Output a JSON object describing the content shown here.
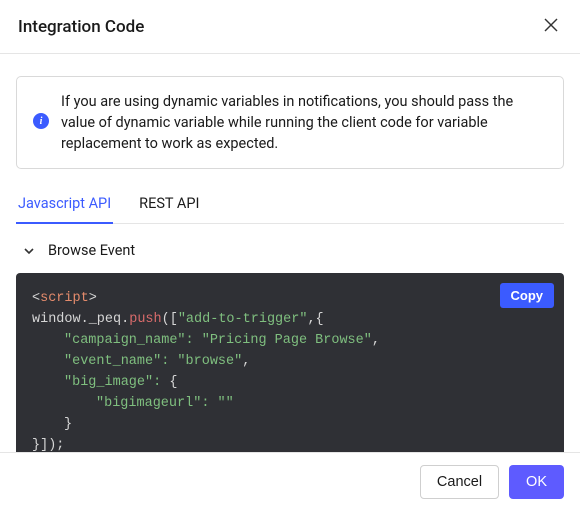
{
  "header": {
    "title": "Integration Code"
  },
  "info": {
    "text": "If you are using dynamic variables in notifications, you should pass the value of dynamic variable while running the client code for variable replacement to work as expected."
  },
  "tabs": {
    "js": "Javascript API",
    "rest": "REST API"
  },
  "section": {
    "title": "Browse Event"
  },
  "code": {
    "copy_label": "Copy",
    "script_tag": "script",
    "window_peq": "window._peq.",
    "push": "push",
    "open": "([",
    "add_to_trigger": "\"add-to-trigger\"",
    "after_trigger": ",{",
    "campaign_key": "\"campaign_name\": ",
    "campaign_val": "\"Pricing Page Browse\"",
    "event_key": "\"event_name\": ",
    "event_val": "\"browse\"",
    "bigimage_key": "\"big_image\": ",
    "bigimage_open": "{",
    "bigimageurl_key": "\"bigimageurl\": ",
    "bigimageurl_val": "\"\"",
    "close_brace": "}",
    "close_all": "}]);"
  },
  "footer": {
    "cancel": "Cancel",
    "ok": "OK"
  }
}
